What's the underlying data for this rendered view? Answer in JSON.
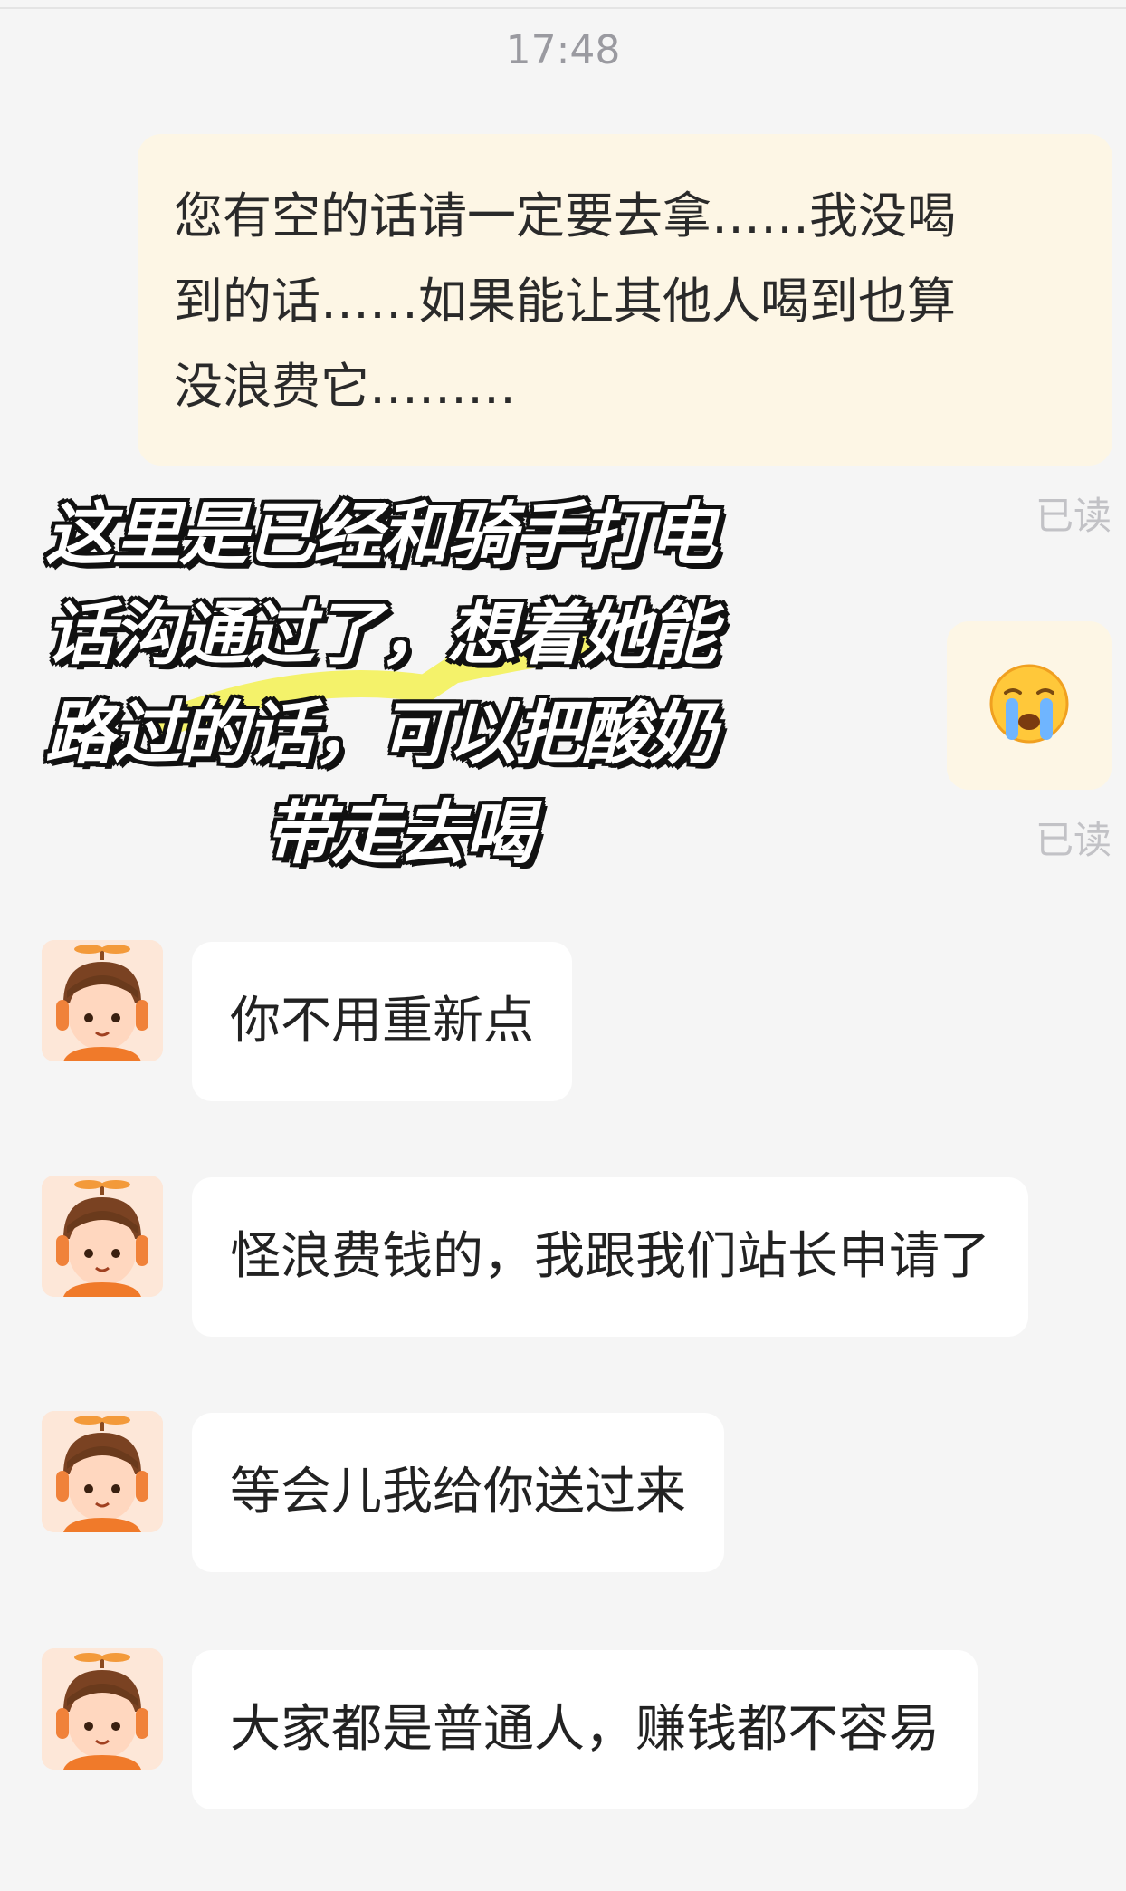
{
  "chat": {
    "timestamp": "17:48",
    "outgoing_message": {
      "lines": [
        "您有空的话请一定要去拿……我没喝",
        "到的话……如果能让其他人喝到也算",
        "没浪费它………"
      ],
      "status": "已读"
    },
    "outgoing_sticker": {
      "icon": "crying-face-icon",
      "status": "已读"
    },
    "overlay_caption": {
      "lines": [
        "这里是已经和骑手打电",
        "话沟通过了，想着她能",
        "路过的话，可以把酸奶",
        "带走去喝"
      ]
    },
    "incoming_messages": [
      {
        "text": "你不用重新点"
      },
      {
        "text": "怪浪费钱的，我跟我们站长申请了"
      },
      {
        "text": "等会儿我给你送过来"
      },
      {
        "text": "大家都是普通人，赚钱都不容易"
      }
    ]
  },
  "colors": {
    "background": "#f5f5f5",
    "outgoing_bubble": "#fdf6e5",
    "incoming_bubble": "#ffffff",
    "read_status": "#c2c2c6",
    "timestamp": "#9a9aa0",
    "highlight_stroke": "#f4f26a"
  }
}
